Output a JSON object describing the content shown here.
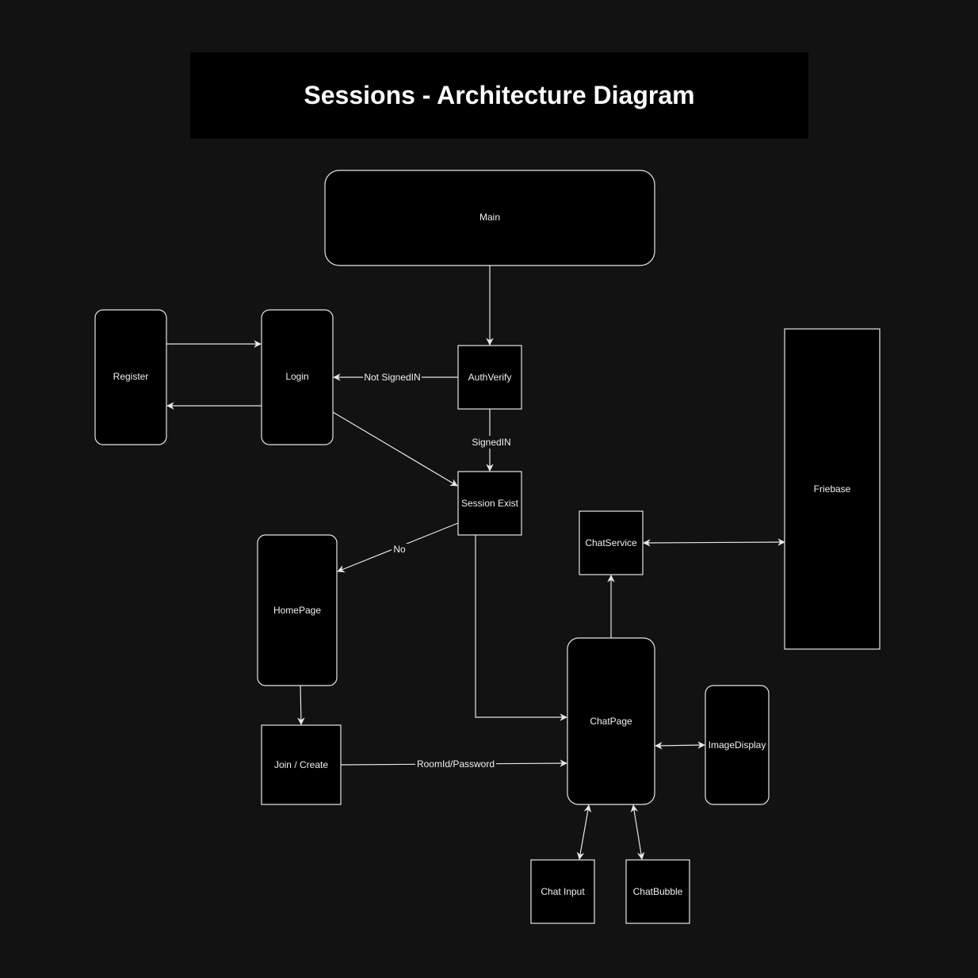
{
  "title": "Sessions - Architecture Diagram",
  "nodes": {
    "main": "Main",
    "register": "Register",
    "login": "Login",
    "auth_verify": "AuthVerify",
    "session_exist": "Session Exist",
    "home_page": "HomePage",
    "join_create": "Join / Create",
    "chat_service": "ChatService",
    "friebase": "Friebase",
    "chat_page": "ChatPage",
    "image_display": "ImageDisplay",
    "chat_input": "Chat Input",
    "chat_bubble": "ChatBubble"
  },
  "edge_labels": {
    "not_signed_in": "Not SignedIN",
    "signed_in": "SignedIN",
    "no": "No",
    "room_password": "RoomId/Password"
  }
}
